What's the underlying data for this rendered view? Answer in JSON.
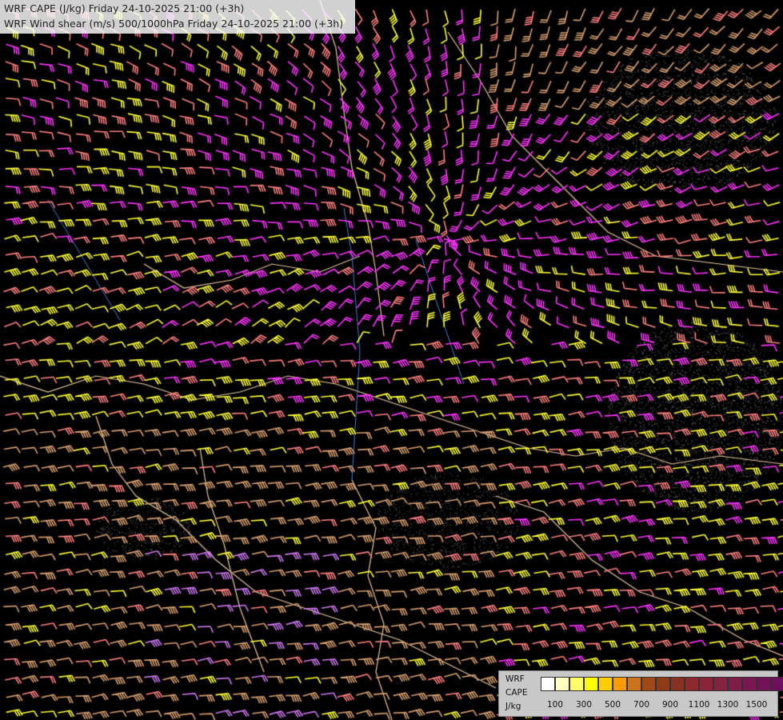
{
  "header": {
    "line1": "WRF CAPE (J/kg) Friday 24-10-2025 21:00 (+3h)",
    "line2": "WRF Wind shear (m/s) 500/1000hPa Friday 24-10-2025 21:00 (+3h)"
  },
  "legend": {
    "label_line1": "WRF",
    "label_line2": "CAPE",
    "label_line3": "J/kg",
    "colors": [
      "#ffffff",
      "#ffffc0",
      "#ffff66",
      "#ffff00",
      "#ffcc00",
      "#ff9900",
      "#c8741f",
      "#9f4a16",
      "#8f3b1a",
      "#8a3126",
      "#8c2a2e",
      "#8a2438",
      "#862140",
      "#801c48",
      "#7a1750",
      "#731257",
      "#6e0e5f"
    ],
    "ticks": [
      "100",
      "300",
      "500",
      "700",
      "900",
      "1100",
      "1300",
      "1500"
    ]
  },
  "map": {
    "barb_colors": {
      "magenta": "#ff33ff",
      "yellow": "#ffff33",
      "salmon": "#ff8080",
      "tan": "#d8a070",
      "violet": "#cc77ee"
    }
  }
}
